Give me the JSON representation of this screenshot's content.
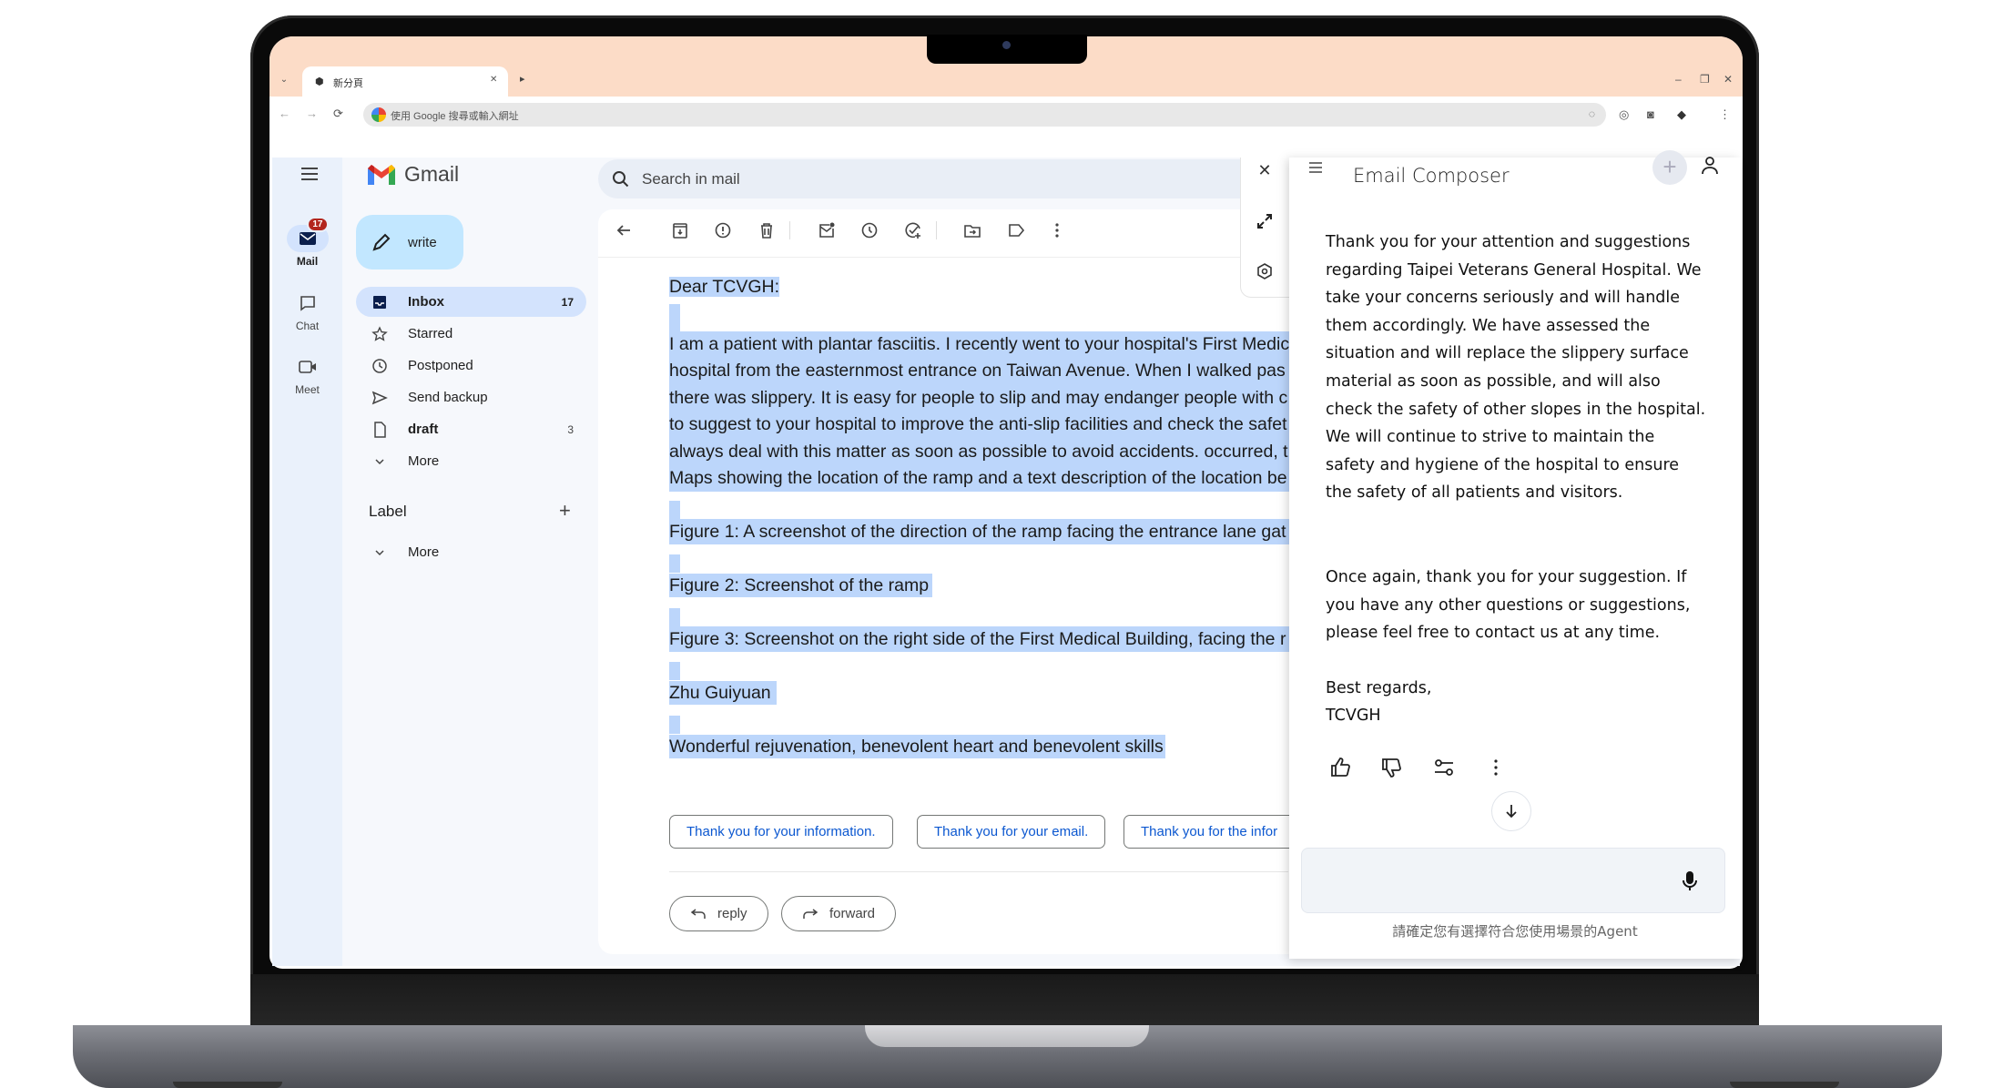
{
  "browser": {
    "tab_title": "新分頁",
    "omnibox_placeholder": "使用 Google 搜尋或輸入網址",
    "window_controls": [
      "minimize",
      "restore",
      "close"
    ]
  },
  "gmail": {
    "app_name": "Gmail",
    "rail": [
      {
        "label": "Mail",
        "icon": "mail-icon",
        "badge": "17",
        "active": true
      },
      {
        "label": "Chat",
        "icon": "chat-icon"
      },
      {
        "label": "Meet",
        "icon": "video-icon"
      }
    ],
    "compose_label": "write",
    "nav": [
      {
        "label": "Inbox",
        "count": "17",
        "icon": "inbox-icon",
        "active": true
      },
      {
        "label": "Starred",
        "count": "",
        "icon": "star-icon"
      },
      {
        "label": "Postponed",
        "count": "",
        "icon": "clock-icon"
      },
      {
        "label": "Send backup",
        "count": "",
        "icon": "send-icon"
      },
      {
        "label": "draft",
        "count": "3",
        "icon": "draft-icon",
        "bold": true
      },
      {
        "label": "More",
        "count": "",
        "icon": "chevron-down-icon"
      }
    ],
    "labels_heading": "Label",
    "labels_more": "More",
    "search_placeholder": "Search in mail",
    "toolbar": [
      "back-arrow-icon",
      "archive-icon",
      "report-spam-icon",
      "delete-icon",
      "mark-unread-icon",
      "snooze-icon",
      "add-task-icon",
      "move-to-icon",
      "label-icon",
      "more-vert-icon"
    ]
  },
  "email": {
    "greeting": "Dear TCVGH:",
    "paragraph_lines": [
      "I am a patient with plantar fasciitis. I recently went to your hospital's First Medic",
      "hospital from the easternmost entrance on Taiwan Avenue. When I walked pas",
      "there was slippery. It is easy for people to slip and may endanger people with c",
      "to suggest to your hospital to improve the anti-slip facilities and check the safet",
      "always deal with this matter as soon as possible to avoid accidents. occurred, t",
      "Maps showing the location of the ramp and a text description of the location be"
    ],
    "figure1": "Figure 1: A screenshot of the direction of the ramp facing the entrance lane gat",
    "figure2": "Figure 2: Screenshot of the ramp",
    "figure3": "Figure 3: Screenshot on the right side of the First Medical Building, facing the r",
    "signature": "Zhu Guiyuan",
    "motto": "Wonderful rejuvenation, benevolent heart and benevolent skills",
    "smart_replies": [
      "Thank you for your information.",
      "Thank you for your email.",
      "Thank you for the infor"
    ],
    "reply_label": "reply",
    "forward_label": "forward"
  },
  "composer": {
    "title": "Email Composer",
    "paragraph1": "Thank you for your attention and suggestions regarding Taipei Veterans General Hospital. We take your concerns seriously and will handle them accordingly. We have assessed the situation and will replace the slippery surface material as soon as possible, and will also check the safety of other slopes in the hospital. We will continue to strive to maintain the safety and hygiene of the hospital to ensure the safety of all patients and visitors.",
    "paragraph2": "Once again, thank you for your suggestion. If you have any other questions or suggestions, please feel free to contact us at any time.",
    "closing": "Best regards,",
    "sender": "TCVGH",
    "input_value": "",
    "hint": "請確定您有選擇符合您使用場景的Agent"
  }
}
